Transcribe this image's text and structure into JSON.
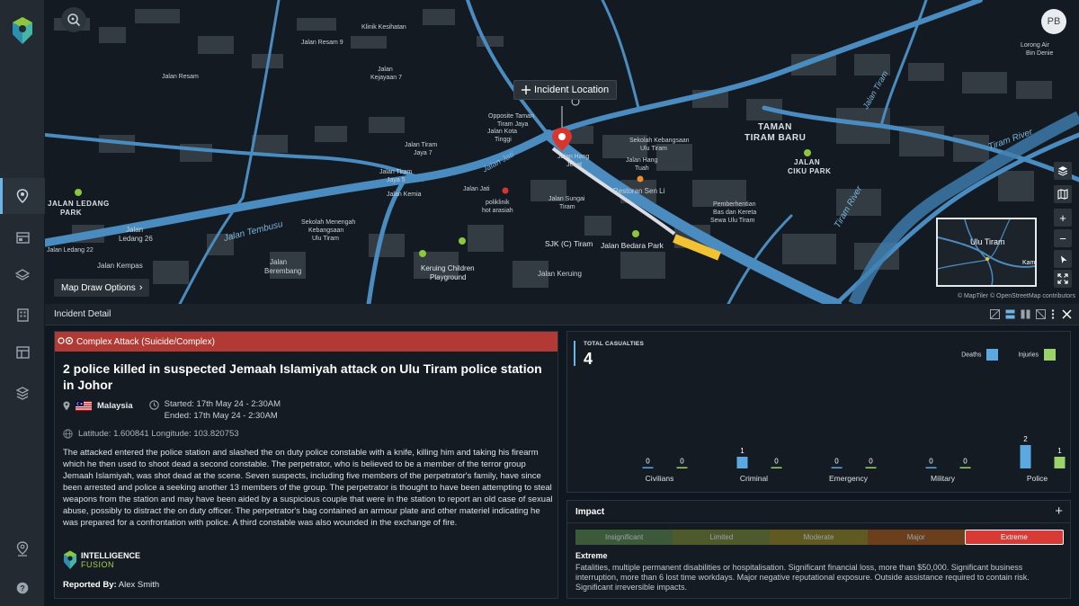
{
  "user": {
    "initials": "PB"
  },
  "map": {
    "incident_tag": "Incident Location",
    "draw_options": "Map Draw Options",
    "attribution": "© MapTiler © OpenStreetMap contributors",
    "minimap_label": "Ulu Tiram",
    "minimap_edge": "Kam",
    "labels": {
      "taman_tiram_baru_1": "TAMAN",
      "taman_tiram_baru_2": "TIRAM BARU",
      "jalan_ciku_park_1": "JALAN",
      "jalan_ciku_park_2": "CIKU PARK",
      "jalan_ledang_park_1": "JALAN LEDANG",
      "jalan_ledang_park_2": "PARK",
      "jalan_tembusu": "Jalan Tembusu",
      "jalan_jati": "Jalan Jati",
      "tiram_river": "Tiram River",
      "jalan_tiram": "Jalan Tiram",
      "jalan_bedara_park": "Jalan Bedara Park",
      "sjk_tiram": "SJK (C) Tiram",
      "keruing_playground_1": "Keruing Children",
      "keruing_playground_2": "Playground",
      "jalan_keruing": "Jalan Keruing",
      "restoran": "Restoran Sen Li",
      "jalan_kempas": "Jalan Kempas",
      "jalan_ledang_26_1": "Jalan",
      "jalan_ledang_26_2": "Ledang 26",
      "jalan_berembang_1": "Jalan",
      "jalan_berembang_2": "Berembang",
      "sekolah_menengah_1": "Sekolah Menengah",
      "sekolah_menengah_2": "Kebangsaan",
      "sekolah_menengah_3": "Ulu Tiram",
      "sekolah_kebangsaan_1": "Sekolah Kebangsaan",
      "sekolah_kebangsaan_2": "Ulu Tiram",
      "jalan_hang_tuah_1": "Jalan Hang",
      "jalan_hang_tuah_2": "Tuah",
      "jalan_hang_jebat_1": "Jalan Hang",
      "jalan_hang_jebat_2": "Jebat",
      "jalan_sungai_tiram_1": "Jalan Sungai",
      "jalan_sungai_tiram_2": "Tiram",
      "jalan_tiram_jaya_5_1": "Jalan Tiram",
      "jalan_tiram_jaya_5_2": "Jaya 5",
      "jalan_kemia": "Jalan Kemia",
      "jalan_jati_2": "Jalan Jati",
      "jalan_kota_tinggi_1": "Jalan Kota",
      "jalan_kota_tinggi_2": "Tinggi",
      "jalan_resam": "Jalan Resam",
      "jalan_kejayaan_7_1": "Jalan",
      "jalan_kejayaan_7_2": "Kejayaan 7",
      "klinik_kesihatan": "Klinik Kesihatan",
      "jalan_resam_9": "Jalan Resam 9",
      "jalan_tiram_jaya_7_1": "Jalan Tiram",
      "jalan_tiram_jaya_7_2": "Jaya 7",
      "jalan_kebangsaan": "Jalan Kebangsaan",
      "pemberhentian_1": "Pemberhentian",
      "pemberhentian_2": "Bas dan Kereta",
      "pemberhentian_3": "Sewa Ulu Tiram",
      "poliklinik_1": "poliklinik",
      "poliklinik_2": "hot arasiah",
      "jalan_bunga": "Jalan Ciku",
      "tiram_river_2": "Tiram River",
      "opposite_taman_1": "Opposite Taman",
      "opposite_taman_2": "Tiram Jaya",
      "lorong_air_1": "Lorong Air",
      "lorong_air_2": "Bin Denie",
      "jalan_tiram_side": "Jalan Tiram",
      "jalan_ledang_22": "Jalan Ledang 22"
    }
  },
  "detail": {
    "title": "Incident Detail",
    "category": "Complex Attack (Suicide/Complex)",
    "headline": "2 police killed in suspected Jemaah Islamiyah attack on Ulu Tiram police station in Johor",
    "country": "Malaysia",
    "started": "Started: 17th May 24 - 2:30AM",
    "ended": "Ended: 17th May 24 - 2:30AM",
    "coords": "Latitude: 1.600841 Longitude: 103.820753",
    "body": "The attacked entered the police station and slashed the on duty police constable with a knife, killing him and taking his firearm which he then used to shoot dead a second constable. The perpetrator, who is believed to be a member of the terror group Jemaah Islamiyah, was shot dead at the scene. Seven suspects, including five members of the perpetrator's family, have since been arrested and police a seeking another 13 members of the group. The perpetrator is thought to have been attempting to steal weapons from the station and may have been aided by a suspicious couple that were in the station to report an old case of sexual abuse, possibly to distract the on duty officer. The perpetrator's bag contained an armour plate and other materiel indicating he was prepared for a confrontation with police. A third constable was also wounded in the exchange of fire.",
    "source_line1": "INTELLIGENCE",
    "source_line2": "FUSION",
    "reported_label": "Reported By:",
    "reported_by": "Alex Smith"
  },
  "casualties": {
    "label": "TOTAL CASUALTIES",
    "total": "4"
  },
  "chart_data": {
    "type": "bar",
    "categories": [
      "Civilians",
      "Criminal",
      "Emergency",
      "Military",
      "Police"
    ],
    "series": [
      {
        "name": "Deaths",
        "values": [
          0,
          1,
          0,
          0,
          2
        ],
        "color": "#5aa9e0"
      },
      {
        "name": "Injuries",
        "values": [
          0,
          0,
          0,
          0,
          1
        ],
        "color": "#9bd36a"
      }
    ],
    "title": "TOTAL CASUALTIES",
    "ylim": [
      0,
      2
    ],
    "legend": "top-right"
  },
  "impact": {
    "title": "Impact",
    "scale": [
      "Insignificant",
      "Limited",
      "Moderate",
      "Major",
      "Extreme"
    ],
    "scale_colors": [
      "#3c5a3a",
      "#4e5a2b",
      "#5f5a22",
      "#6b3f1c",
      "#d83a36"
    ],
    "selected": "Extreme",
    "description": "Fatalities, multiple permanent disabilities or hospitalisation. Significant financial loss, more than $50,000. Significant business interruption, more than 6 lost time workdays. Major negative reputational exposure. Outside assistance required to contain risk. Significant irreversible impacts."
  },
  "colors": {
    "accent": "#6db4e6",
    "category_red": "#b23a34",
    "brand_green": "#8dc63f"
  }
}
